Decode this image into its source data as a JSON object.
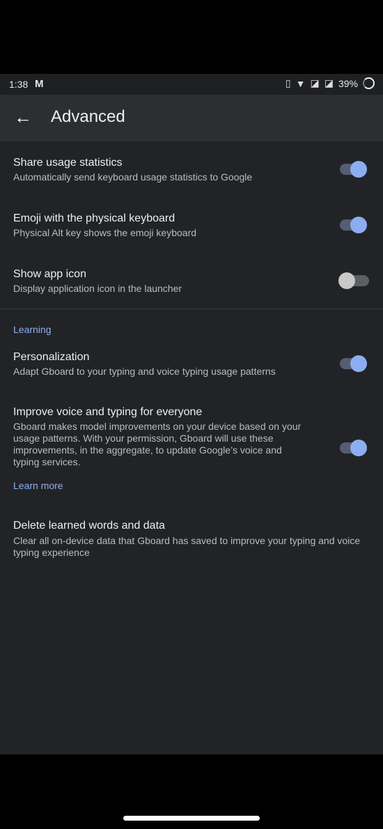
{
  "status": {
    "time": "1:38",
    "battery": "39%"
  },
  "appbar": {
    "title": "Advanced"
  },
  "settings": [
    {
      "title": "Share usage statistics",
      "subtitle": "Automatically send keyboard usage statistics to Google",
      "on": true
    },
    {
      "title": "Emoji with the physical keyboard",
      "subtitle": "Physical Alt key shows the emoji keyboard",
      "on": true
    },
    {
      "title": "Show app icon",
      "subtitle": "Display application icon in the launcher",
      "on": false
    }
  ],
  "learning": {
    "header": "Learning",
    "personalization": {
      "title": "Personalization",
      "subtitle": "Adapt Gboard to your typing and voice typing usage patterns",
      "on": true
    },
    "improve": {
      "title": "Improve voice and typing for everyone",
      "subtitle": "Gboard makes model improvements on your device based on your usage patterns. With your permission, Gboard will use these improvements, in the aggregate, to update Google’s voice and typing services.",
      "on": true,
      "link": "Learn more"
    },
    "delete": {
      "title": "Delete learned words and data",
      "subtitle": "Clear all on-device data that Gboard has saved to improve your typing and voice typing experience"
    }
  }
}
